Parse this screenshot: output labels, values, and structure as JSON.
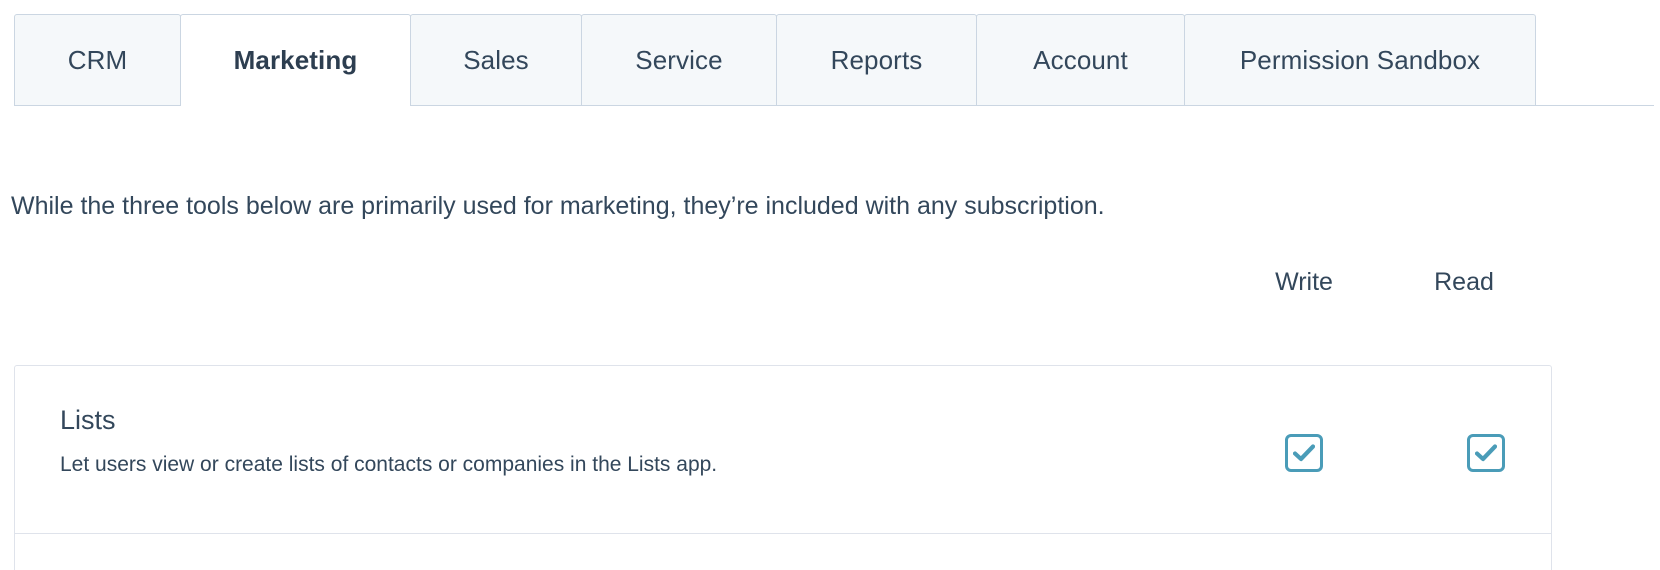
{
  "tabs": [
    {
      "label": "CRM",
      "active": false
    },
    {
      "label": "Marketing",
      "active": true
    },
    {
      "label": "Sales",
      "active": false
    },
    {
      "label": "Service",
      "active": false
    },
    {
      "label": "Reports",
      "active": false
    },
    {
      "label": "Account",
      "active": false
    },
    {
      "label": "Permission Sandbox",
      "active": false
    }
  ],
  "intro": "While the three tools below are primarily used for marketing, they’re included with any subscription.",
  "columns": {
    "write": "Write",
    "read": "Read"
  },
  "permissions": [
    {
      "title": "Lists",
      "description": "Let users view or create lists of contacts or companies in the Lists app.",
      "write_checked": true,
      "read_checked": true
    }
  ],
  "colors": {
    "checkbox_accent": "#4a9cb8",
    "text": "#33475b",
    "tab_inactive_bg": "#f5f8fa",
    "border": "#cbd6e2",
    "card_border": "#dfe3eb"
  }
}
